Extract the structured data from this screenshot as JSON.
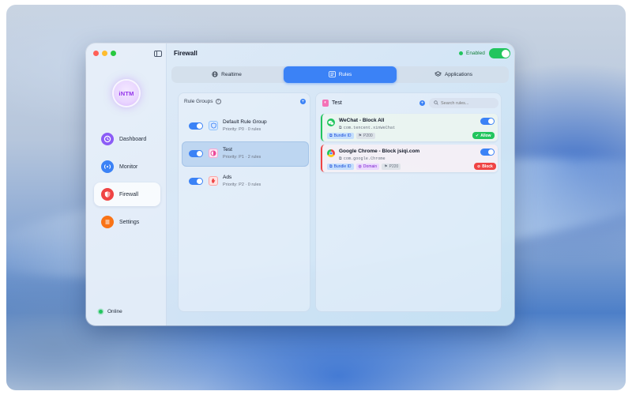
{
  "app": {
    "title": "Firewall",
    "enabled_label": "Enabled",
    "avatar_text": "iNTM"
  },
  "sidebar": {
    "items": [
      {
        "label": "Dashboard",
        "icon": "clock-icon",
        "color": "#8b5cf6"
      },
      {
        "label": "Monitor",
        "icon": "signal-icon",
        "color": "#3b82f6"
      },
      {
        "label": "Firewall",
        "icon": "shield-icon",
        "color": "#ef4444",
        "active": true
      },
      {
        "label": "Settings",
        "icon": "list-icon",
        "color": "#f97316"
      }
    ],
    "status": "Online"
  },
  "tabs": [
    {
      "label": "Realtime",
      "icon": "globe-icon"
    },
    {
      "label": "Rules",
      "icon": "list-icon",
      "active": true
    },
    {
      "label": "Applications",
      "icon": "layers-icon"
    }
  ],
  "rule_groups": {
    "title": "Rule Groups",
    "help": "?",
    "add": "+",
    "items": [
      {
        "name": "Default Rule Group",
        "meta": "Priority: P0  ·  0 rules",
        "icon": "shield-icon",
        "color": "#dbeafe",
        "icon_color": "#3b82f6",
        "enabled": true
      },
      {
        "name": "Test",
        "meta": "Priority: P1  ·  2 rules",
        "icon": "half-circle-icon",
        "color": "#fce7f3",
        "icon_color": "#ec4899",
        "enabled": true,
        "selected": true
      },
      {
        "name": "Ads",
        "meta": "Priority: P2  ·  0 rules",
        "icon": "hand-icon",
        "color": "#fee2e2",
        "icon_color": "#ef4444",
        "enabled": true
      }
    ]
  },
  "rules_panel": {
    "title": "Test",
    "add": "+",
    "search_placeholder": "Search rules...",
    "rules": [
      {
        "name": "WeChat - Block All",
        "identifier": "com.tencent.xinWeChat",
        "tags": [
          "Bundle ID",
          "P200"
        ],
        "action": "Allow",
        "icon": "wechat-icon",
        "enabled": true
      },
      {
        "name": "Google Chrome - Block jsiqi.com",
        "identifier": "com.google.Chrome",
        "tags": [
          "Bundle ID",
          "Domain",
          "P220"
        ],
        "action": "Block",
        "icon": "chrome-icon",
        "enabled": true
      }
    ]
  }
}
